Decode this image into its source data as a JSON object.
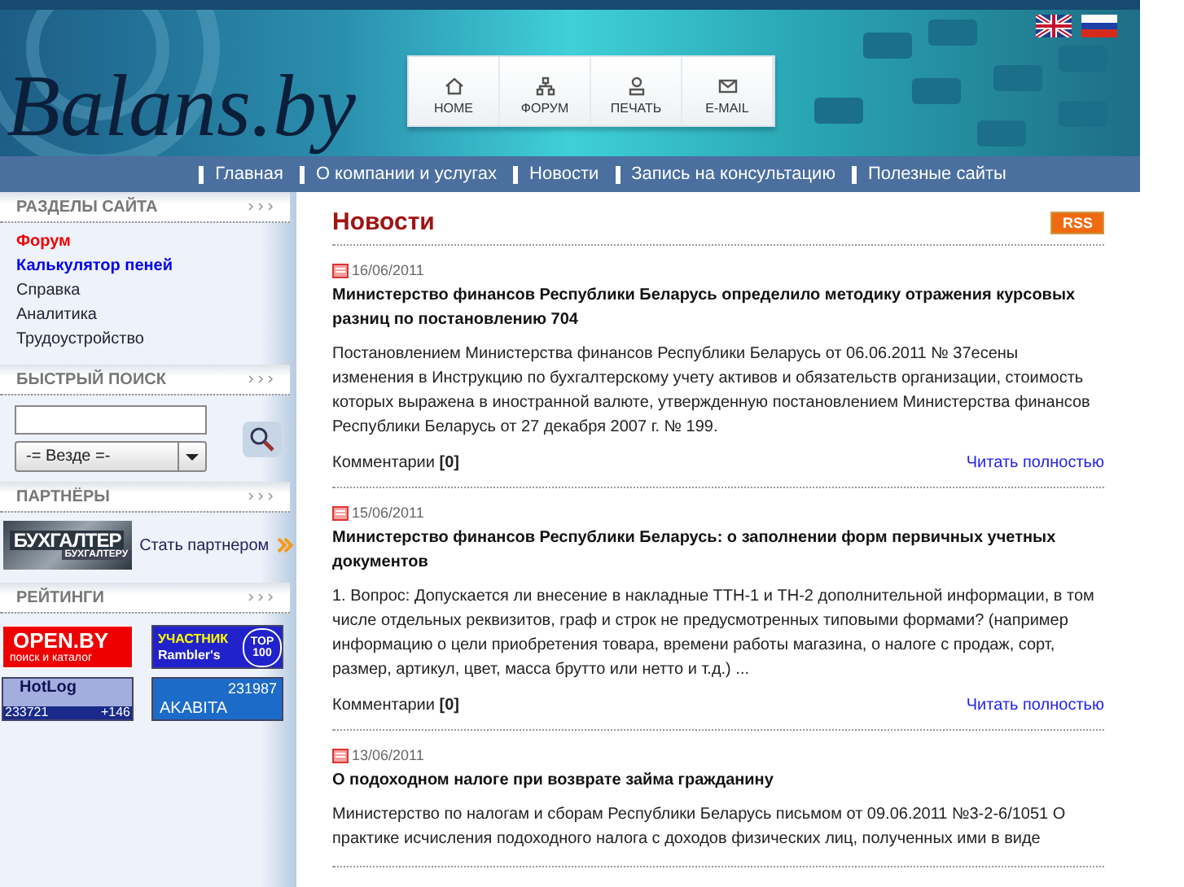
{
  "header": {
    "logo": "Balans.by",
    "quick_links": [
      {
        "kind": "home",
        "label": "HOME"
      },
      {
        "kind": "forum",
        "label": "ФОРУМ"
      },
      {
        "kind": "print",
        "label": "ПЕЧАТЬ"
      },
      {
        "kind": "mail",
        "label": "E-MAIL"
      }
    ],
    "languages": [
      {
        "kind": "uk"
      },
      {
        "kind": "ru"
      }
    ]
  },
  "nav": [
    "Главная",
    "О компании и услугах",
    "Новости",
    "Запись на консультацию",
    "Полезные сайты"
  ],
  "sidebar": {
    "sections_title": "РАЗДЕЛЫ САЙТА",
    "sections": [
      {
        "label": "Форум",
        "kind": "highlight"
      },
      {
        "label": "Калькулятор пеней",
        "kind": "bold"
      },
      {
        "label": "Справка",
        "kind": "plain"
      },
      {
        "label": "Аналитика",
        "kind": "plain"
      },
      {
        "label": "Трудоустройство",
        "kind": "plain"
      }
    ],
    "search_title": "БЫСТРЫЙ ПОИСК",
    "search_scope": "-= Везде =-",
    "partners_title": "ПАРТНЁРЫ",
    "partner_banner": {
      "title": "БУХГАЛТЕР",
      "subtitle": "БУХГАЛТЕРУ"
    },
    "partner_link": "Стать партнером",
    "ratings_title": "РЕЙТИНГИ",
    "ratings": [
      {
        "kind": "openby",
        "lines": [
          "OPEN.BY",
          "поиск и каталог"
        ]
      },
      {
        "kind": "rambler",
        "lines": [
          "УЧАСТНИК",
          "Rambler's",
          "TOP",
          "100"
        ]
      },
      {
        "kind": "hotlog",
        "lines": [
          "HotLog",
          "233721",
          "+146"
        ]
      },
      {
        "kind": "akavita",
        "lines": [
          "231987",
          "AKABITA"
        ]
      }
    ]
  },
  "content": {
    "title": "Новости",
    "rss": "RSS",
    "news": [
      {
        "date": "16/06/2011",
        "title": "Министерство финансов Республики Беларусь определило методику отражения курсовых разниц по постановлению 704",
        "body": "Постановлением Министерства финансов Республики Беларусь от  06.06.2011  №  37есены изменения в Инструкцию по бухгалтерскому учету активов и обязательств организации, стоимость которых выражена в иностранной валюте, утвержденную постановлением Министерства финансов Республики Беларусь от 27 декабря 2007 г. № 199.",
        "comments": "Комментарии **[0]**",
        "more": "Читать полностью"
      },
      {
        "date": "15/06/2011",
        "title": "Министерство финансов Республики Беларусь: о заполнении форм первичных учетных документов",
        "body": "1. Вопрос: Допускается ли внесение в накладные ТТН-1 и ТН-2 дополнительной информации, в том числе отдельных реквизитов, граф и строк не предусмотренных типовыми формами?  (например информацию о цели приобретения товара, времени работы магазина, о налоге с продаж, сорт, размер, артикул, цвет, масса брутто или нетто и т.д.) ...",
        "comments": "Комментарии **[0]**",
        "more": "Читать полностью"
      },
      {
        "date": "13/06/2011",
        "title": "О подоходном налоге при возврате займа гражданину",
        "body": "Министерство по налогам и сборам Республики Беларусь письмом от  09.06.2011  №3-2-6/1051 О практике исчисления подоходного налога с доходов физических лиц, полученных ими в виде"
      }
    ]
  }
}
